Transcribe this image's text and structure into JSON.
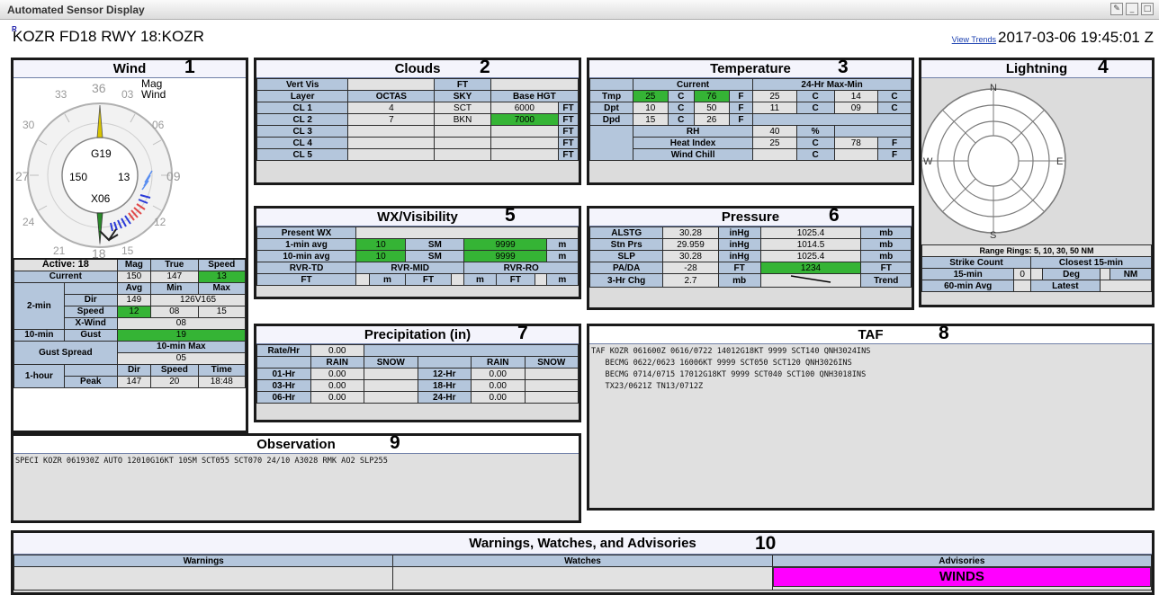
{
  "window": {
    "title": "Automated Sensor Display",
    "btn_edit": "✎",
    "btn_min": "_",
    "btn_max": "□"
  },
  "header": {
    "badge": "R",
    "station": "KOZR FD18 RWY 18:KOZR",
    "view_trends": "View Trends",
    "datetime": "2017-03-06 19:45:01 Z"
  },
  "wind": {
    "title": "Wind",
    "num": "1",
    "dial": {
      "n36": "36",
      "n03": "03",
      "n06": "06",
      "n09": "09",
      "n12": "12",
      "n15": "15",
      "n18": "18",
      "n21": "21",
      "n24": "24",
      "n27": "27",
      "n30": "30",
      "n33": "33",
      "mag1": "Mag",
      "mag2": "Wind",
      "gust": "G19",
      "dir": "150",
      "speed": "13",
      "var": "X06"
    },
    "active": "Active: 18",
    "h_mag": "Mag",
    "h_true": "True",
    "h_speed": "Speed",
    "current": "Current",
    "cur_mag": "150",
    "cur_true": "147",
    "cur_speed": "13",
    "two_min": "2-min",
    "h_avg": "Avg",
    "h_min": "Min",
    "h_max": "Max",
    "dir": "Dir",
    "dir_avg": "149",
    "dir_var": "126V165",
    "speed": "Speed",
    "sp_avg": "12",
    "sp_min": "08",
    "sp_max": "15",
    "xwind": "X-Wind",
    "xwind_val": "08",
    "ten_min": "10-min",
    "gust": "Gust",
    "gust_val": "19",
    "gust_spread": "Gust Spread",
    "ten_min_max": "10-min Max",
    "gs_val": "05",
    "one_hour": "1-hour",
    "h_dir": "Dir",
    "h_spd": "Speed",
    "h_time": "Time",
    "peak": "Peak",
    "pk_dir": "147",
    "pk_spd": "20",
    "pk_time": "18:48"
  },
  "clouds": {
    "title": "Clouds",
    "num": "2",
    "vert_vis": "Vert Vis",
    "ft": "FT",
    "layer": "Layer",
    "octas": "OCTAS",
    "sky": "SKY",
    "base": "Base HGT",
    "rows": [
      {
        "l": "CL 1",
        "o": "4",
        "s": "SCT",
        "b": "6000",
        "u": "FT"
      },
      {
        "l": "CL 2",
        "o": "7",
        "s": "BKN",
        "b": "7000",
        "u": "FT"
      },
      {
        "l": "CL 3",
        "o": "",
        "s": "",
        "b": "",
        "u": "FT"
      },
      {
        "l": "CL 4",
        "o": "",
        "s": "",
        "b": "",
        "u": "FT"
      },
      {
        "l": "CL 5",
        "o": "",
        "s": "",
        "b": "",
        "u": "FT"
      }
    ]
  },
  "temp": {
    "title": "Temperature",
    "num": "3",
    "current": "Current",
    "maxmin": "24-Hr Max-Min",
    "tmp": "Tmp",
    "tmp_c": "25",
    "tmp_f": "76",
    "tmp_max": "25",
    "tmp_min": "14",
    "dpt": "Dpt",
    "dpt_c": "10",
    "dpt_f": "50",
    "dpt_max": "11",
    "dpt_min": "09",
    "dpd": "Dpd",
    "dpd_c": "15",
    "dpd_f": "26",
    "rh": "RH",
    "rh_val": "40",
    "pct": "%",
    "hi": "Heat Index",
    "hi_c": "25",
    "hi_f": "78",
    "wc": "Wind Chill",
    "c": "C",
    "f": "F"
  },
  "lightning": {
    "title": "Lightning",
    "num": "4",
    "n": "N",
    "e": "E",
    "s": "S",
    "w": "W",
    "rings": "Range Rings: 5, 10, 30, 50 NM",
    "strike": "Strike Count",
    "closest": "Closest 15-min",
    "m15": "15-min",
    "m15_val": "0",
    "deg": "Deg",
    "nm": "NM",
    "m60": "60-min Avg",
    "latest": "Latest"
  },
  "wx": {
    "title": "WX/Visibility",
    "num": "5",
    "present": "Present WX",
    "one": "1-min avg",
    "one_sm": "10",
    "sm": "SM",
    "one_m": "9999",
    "m": "m",
    "ten": "10-min avg",
    "ten_sm": "10",
    "ten_m": "9999",
    "td": "RVR-TD",
    "mid": "RVR-MID",
    "ro": "RVR-RO",
    "ft": "FT"
  },
  "pressure": {
    "title": "Pressure",
    "num": "6",
    "rows": [
      {
        "l": "ALSTG",
        "a": "30.28",
        "u1": "inHg",
        "b": "1025.4",
        "u2": "mb"
      },
      {
        "l": "Stn Prs",
        "a": "29.959",
        "u1": "inHg",
        "b": "1014.5",
        "u2": "mb"
      },
      {
        "l": "SLP",
        "a": "30.28",
        "u1": "inHg",
        "b": "1025.4",
        "u2": "mb"
      },
      {
        "l": "PA/DA",
        "a": "-28",
        "u1": "FT",
        "b": "1234",
        "u2": "FT"
      },
      {
        "l": "3-Hr Chg",
        "a": "2.7",
        "u1": "mb",
        "b": "",
        "u2": "Trend"
      }
    ]
  },
  "precip": {
    "title": "Precipitation (in)",
    "num": "7",
    "rate": "Rate/Hr",
    "rate_val": "0.00",
    "rain": "RAIN",
    "snow": "SNOW",
    "r1": "01-Hr",
    "r1v": "0.00",
    "r12": "12-Hr",
    "r12v": "0.00",
    "r3": "03-Hr",
    "r3v": "0.00",
    "r18": "18-Hr",
    "r18v": "0.00",
    "r6": "06-Hr",
    "r6v": "0.00",
    "r24": "24-Hr",
    "r24v": "0.00"
  },
  "taf": {
    "title": "TAF",
    "num": "8",
    "text": "TAF KOZR 061600Z 0616/0722 14012G18KT 9999 SCT140 QNH3024INS\n   BECMG 0622/0623 16006KT 9999 SCT050 SCT120 QNH3026INS\n   BECMG 0714/0715 17012G18KT 9999 SCT040 SCT100 QNH3018INS\n   TX23/0621Z TN13/0712Z"
  },
  "obs": {
    "title": "Observation",
    "num": "9",
    "text": "SPECI KOZR 061930Z AUTO 12010G16KT 10SM SCT055 SCT070 24/10 A3028 RMK AO2 SLP255"
  },
  "wwa": {
    "title": "Warnings, Watches, and Advisories",
    "num": "10",
    "warnings": "Warnings",
    "watches": "Watches",
    "advisories": "Advisories",
    "adv_item": "WINDS"
  },
  "colors": {
    "green": "#35b435",
    "header_blue": "#b4c6dc",
    "magenta": "#ff00ff"
  }
}
